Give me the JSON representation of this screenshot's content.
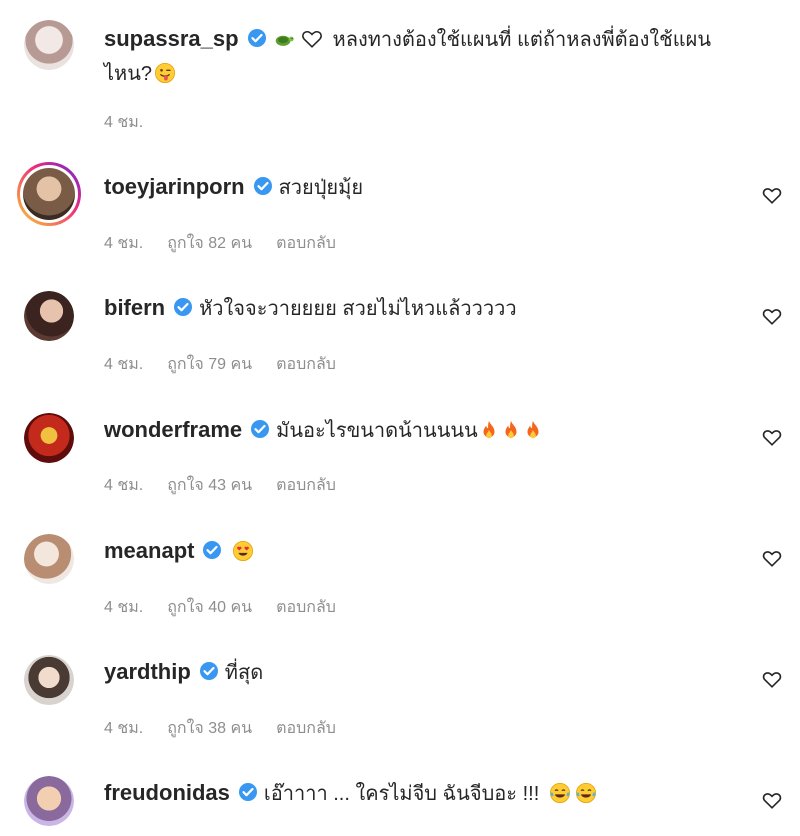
{
  "comments": [
    {
      "username": "supassra_sp",
      "text_before": "",
      "text": "หลงทางต้องใช้แผนที่ แต่ถ้าหลงพี่ต้องใช้แผนไหน?",
      "time": "4 ชม.",
      "likes": "",
      "reply": "",
      "icons": [
        "turtle-emoji",
        "white-heart-emoji",
        "winking-tongue-emoji"
      ],
      "avatar_color": "#d9cfcf"
    },
    {
      "username": "toeyjarinporn",
      "text": "สวยปุ่ยมุ้ย",
      "time": "4 ชม.",
      "likes": "ถูกใจ 82 คน",
      "reply": "ตอบกลับ",
      "avatar_color": "#6b5143"
    },
    {
      "username": "bifern",
      "text": "หัวใจจะวายยยย สวยไม่ไหวแล้ววววว",
      "time": "4 ชม.",
      "likes": "ถูกใจ 79 คน",
      "reply": "ตอบกลับ",
      "avatar_color": "#5a3a33"
    },
    {
      "username": "wonderframe",
      "text": "มันอะไรขนาดน้านนนน",
      "time": "4 ชม.",
      "likes": "ถูกใจ 43 คน",
      "reply": "ตอบกลับ",
      "icons": [
        "fire-emoji",
        "fire-emoji",
        "fire-emoji"
      ],
      "avatar_color": "#7a1212"
    },
    {
      "username": "meanapt",
      "text": "",
      "time": "4 ชม.",
      "likes": "ถูกใจ 40 คน",
      "reply": "ตอบกลับ",
      "icons": [
        "heart-eyes-emoji"
      ],
      "avatar_color": "#e4d7cf"
    },
    {
      "username": "yardthip",
      "text": "ที่สุด",
      "time": "4 ชม.",
      "likes": "ถูกใจ 38 คน",
      "reply": "ตอบกลับ",
      "avatar_color": "#cfc6c0"
    },
    {
      "username": "freudonidas",
      "text": "เอ๊าาาา ... ใครไม่จีบ ฉันจีบอะ !!!",
      "time": "",
      "likes": "",
      "reply": "",
      "icons": [
        "tears-of-joy-emoji",
        "tears-of-joy-emoji"
      ],
      "avatar_color": "#c9b6e6"
    }
  ],
  "colors": {
    "verified": "#3897f0",
    "meta": "#8e8e8e",
    "text": "#262626"
  }
}
